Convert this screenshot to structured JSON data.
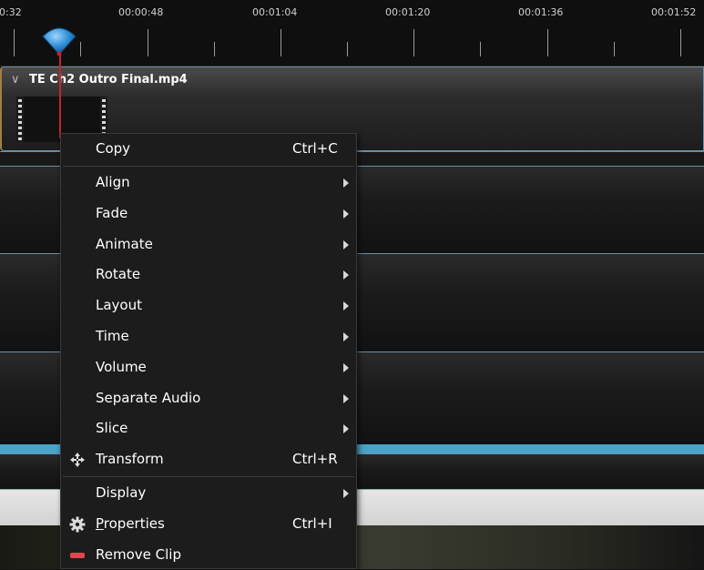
{
  "ruler": {
    "ticks": [
      "0:32",
      "00:00:48",
      "00:01:04",
      "00:01:20",
      "00:01:36",
      "00:01:52"
    ]
  },
  "clip": {
    "title": "TE Ch2 Outro Final.mp4"
  },
  "context_menu": {
    "items": [
      {
        "label": "Copy",
        "shortcut": "Ctrl+C",
        "submenu": false
      },
      {
        "label": "Align",
        "shortcut": "",
        "submenu": true
      },
      {
        "label": "Fade",
        "shortcut": "",
        "submenu": true
      },
      {
        "label": "Animate",
        "shortcut": "",
        "submenu": true
      },
      {
        "label": "Rotate",
        "shortcut": "",
        "submenu": true
      },
      {
        "label": "Layout",
        "shortcut": "",
        "submenu": true
      },
      {
        "label": "Time",
        "shortcut": "",
        "submenu": true
      },
      {
        "label": "Volume",
        "shortcut": "",
        "submenu": true
      },
      {
        "label": "Separate Audio",
        "shortcut": "",
        "submenu": true
      },
      {
        "label": "Slice",
        "shortcut": "",
        "submenu": true
      },
      {
        "label": "Transform",
        "shortcut": "Ctrl+R",
        "submenu": false,
        "icon": "move-arrows-icon"
      },
      {
        "label": "Display",
        "shortcut": "",
        "submenu": true
      },
      {
        "label": "Properties",
        "shortcut": "Ctrl+I",
        "submenu": false,
        "icon": "gear-icon"
      },
      {
        "label": "Remove Clip",
        "shortcut": "",
        "submenu": false,
        "icon": "remove-icon"
      }
    ]
  },
  "colors": {
    "playhead": "#c0272d",
    "playhead_marker": "#2f8fd6",
    "track_accent": "#4aa3c9",
    "remove_icon": "#e0474c"
  }
}
